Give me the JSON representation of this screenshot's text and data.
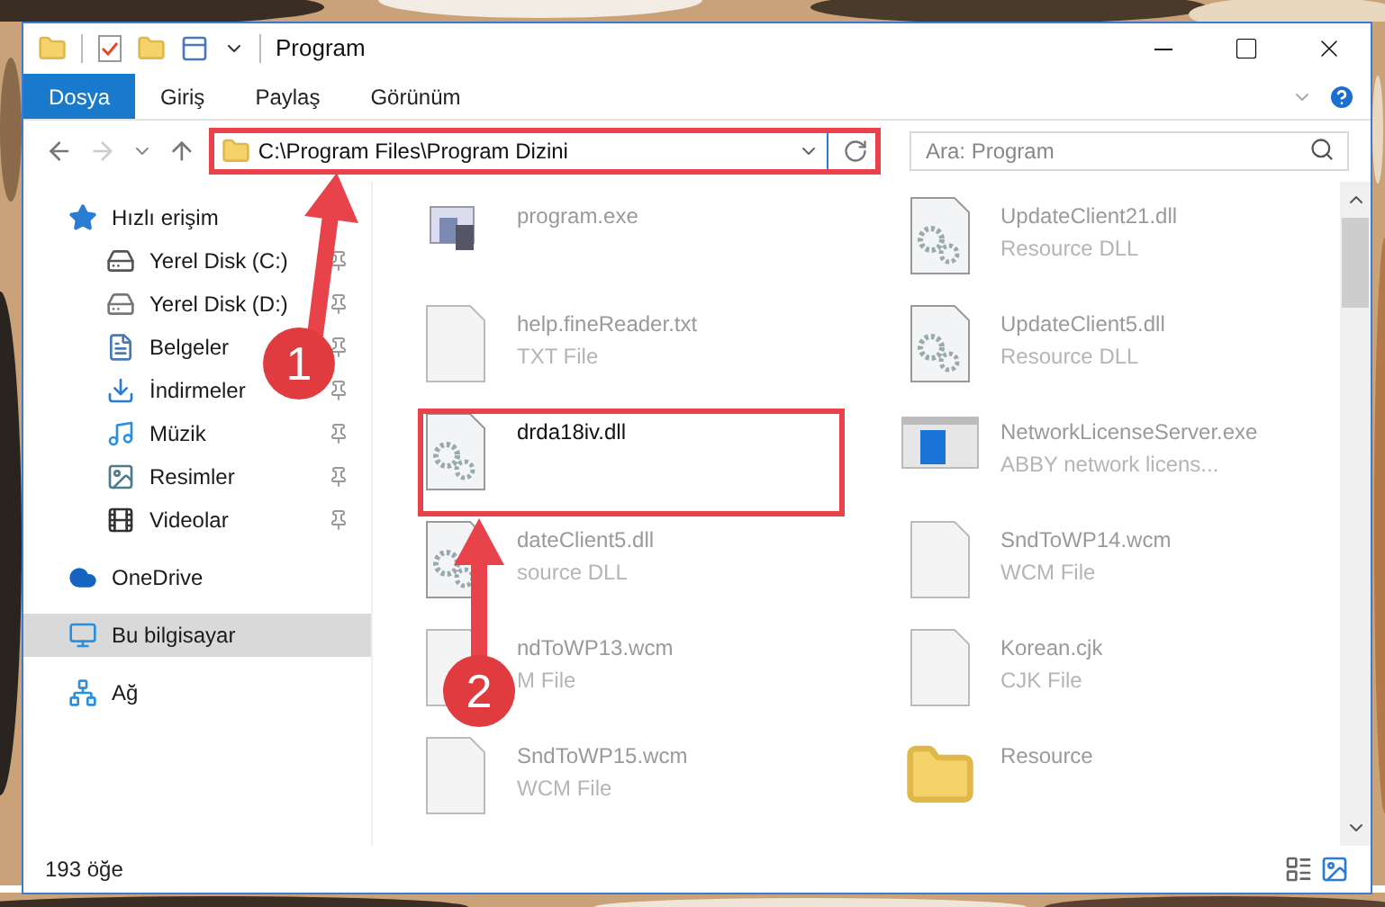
{
  "window": {
    "title": "Program"
  },
  "ribbon_tabs": [
    {
      "label": "Dosya",
      "selected": true
    },
    {
      "label": "Giriş",
      "selected": false
    },
    {
      "label": "Paylaş",
      "selected": false
    },
    {
      "label": "Görünüm",
      "selected": false
    }
  ],
  "address": {
    "path": "C:\\Program Files\\Program Dizini",
    "highlighted": true
  },
  "search": {
    "placeholder": "Ara: Program"
  },
  "sidebar": {
    "items": [
      {
        "label": "Hızlı erişim",
        "kind": "quick",
        "selected": false,
        "children": [
          {
            "label": "Yerel Disk (C:)",
            "kind": "system_drive",
            "pinned": true,
            "selected": false
          },
          {
            "label": "Yerel Disk (D:)",
            "kind": "drive",
            "pinned": true,
            "selected": false
          },
          {
            "label": "Belgeler",
            "kind": "documents",
            "pinned": true,
            "selected": false
          },
          {
            "label": "İndirmeler",
            "kind": "downloads",
            "pinned": true,
            "selected": false
          },
          {
            "label": "Müzik",
            "kind": "music",
            "pinned": true,
            "selected": false
          },
          {
            "label": "Resimler",
            "kind": "pictures",
            "pinned": true,
            "selected": false
          },
          {
            "label": "Videolar",
            "kind": "videos",
            "pinned": true,
            "selected": false
          }
        ]
      },
      {
        "label": "OneDrive",
        "kind": "cloud",
        "selected": false
      },
      {
        "label": "Bu bilgisayar",
        "kind": "computer",
        "selected": true
      },
      {
        "label": "Ağ",
        "kind": "network",
        "selected": false
      }
    ]
  },
  "files": [
    {
      "name": "program.exe",
      "kind": "exe",
      "highlighted": false
    },
    {
      "name": "UpdateClient21.dll",
      "type": "Resource DLL",
      "kind": "dll",
      "highlighted": false
    },
    {
      "name": "help.fineReader.txt",
      "type": "TXT File",
      "kind": "txt",
      "highlighted": false
    },
    {
      "name": "UpdateClient5.dll",
      "type": "Resource DLL",
      "kind": "dll",
      "highlighted": false
    },
    {
      "name": "drda18iv.dll",
      "kind": "dll",
      "highlighted": true
    },
    {
      "name": "NetworkLicenseServer.exe",
      "type": "ABBY network licens...",
      "kind": "app",
      "highlighted": false
    },
    {
      "name": "dateClient5.dll",
      "type": "source DLL",
      "kind": "dll",
      "highlighted": false
    },
    {
      "name": "SndToWP14.wcm",
      "type": "WCM File",
      "kind": "generic",
      "highlighted": false
    },
    {
      "name": "ndToWP13.wcm",
      "type": "M File",
      "kind": "generic",
      "highlighted": false
    },
    {
      "name": "Korean.cjk",
      "type": "CJK File",
      "kind": "generic",
      "highlighted": false
    },
    {
      "name": "SndToWP15.wcm",
      "type": "WCM File",
      "kind": "generic",
      "highlighted": false
    },
    {
      "name": "Resource",
      "kind": "folder",
      "highlighted": false
    }
  ],
  "status_bar": {
    "count": "193 öğe"
  },
  "annotations": [
    {
      "number": "1"
    },
    {
      "number": "2"
    }
  ]
}
